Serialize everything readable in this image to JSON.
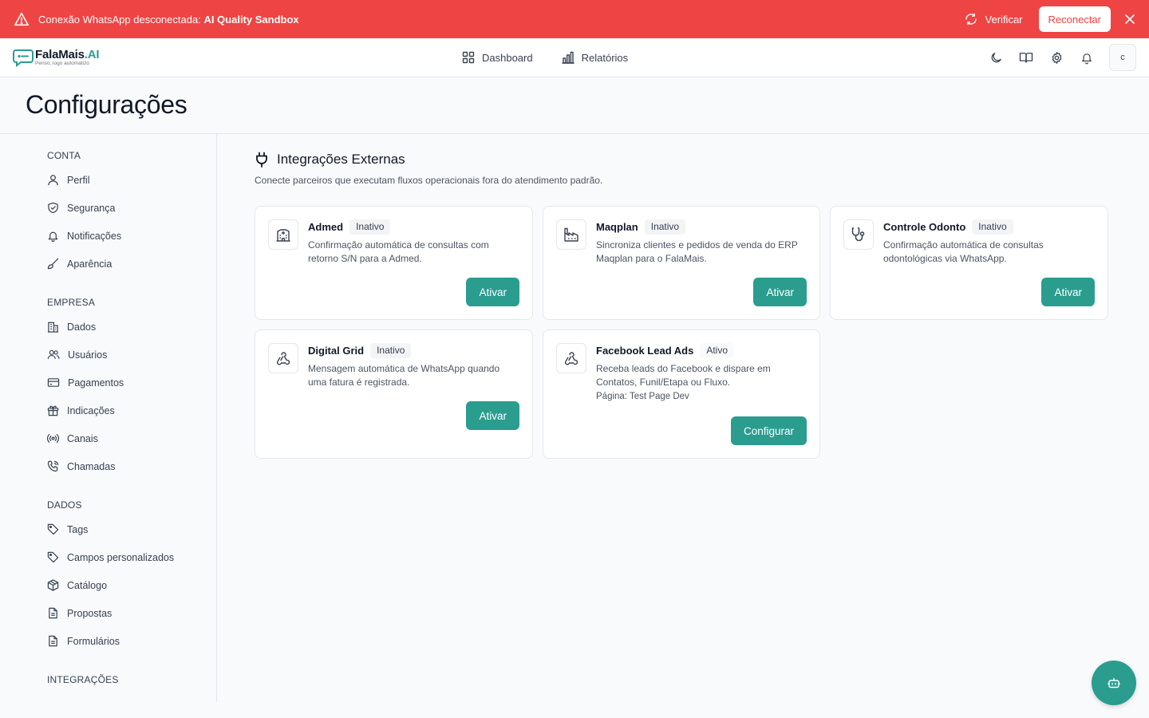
{
  "alert": {
    "message_prefix": "Conexão WhatsApp desconectada:",
    "connection_name": "AI Quality Sandbox",
    "verify_label": "Verificar",
    "reconnect_label": "Reconectar"
  },
  "logo": {
    "brand": "FalaMais",
    "brand_suffix": ".AI",
    "tagline": "Penso, logo automatizo"
  },
  "nav": {
    "dashboard_label": "Dashboard",
    "reports_label": "Relatórios",
    "avatar_initial": "c"
  },
  "page": {
    "title": "Configurações"
  },
  "sidebar": {
    "sections": [
      {
        "title": "CONTA",
        "items": [
          "Perfil",
          "Segurança",
          "Notificações",
          "Aparência"
        ]
      },
      {
        "title": "EMPRESA",
        "items": [
          "Dados",
          "Usuários",
          "Pagamentos",
          "Indicações",
          "Canais",
          "Chamadas"
        ]
      },
      {
        "title": "DADOS",
        "items": [
          "Tags",
          "Campos personalizados",
          "Catálogo",
          "Propostas",
          "Formulários"
        ]
      },
      {
        "title": "INTEGRAÇÕES",
        "items": []
      }
    ]
  },
  "integrations": {
    "title": "Integrações Externas",
    "description": "Conecte parceiros que executam fluxos operacionais fora do atendimento padrão.",
    "cards": [
      {
        "name": "Admed",
        "status": "Inativo",
        "description": "Confirmação automática de consultas com retorno S/N para a Admed.",
        "action": "Ativar",
        "icon": "hospital-icon"
      },
      {
        "name": "Maqplan",
        "status": "Inativo",
        "description": "Sincroniza clientes e pedidos de venda do ERP Maqplan para o FalaMais.",
        "action": "Ativar",
        "icon": "factory-icon"
      },
      {
        "name": "Controle Odonto",
        "status": "Inativo",
        "description": "Confirmação automática de consultas odontológicas via WhatsApp.",
        "action": "Ativar",
        "icon": "stethoscope-icon"
      },
      {
        "name": "Digital Grid",
        "status": "Inativo",
        "description": "Mensagem automática de WhatsApp quando uma fatura é registrada.",
        "action": "Ativar",
        "icon": "webhook-icon"
      },
      {
        "name": "Facebook Lead Ads",
        "status": "Ativo",
        "description": "Receba leads do Facebook e dispare em Contatos, Funil/Etapa ou Fluxo.",
        "extra": "Página: Test Page Dev",
        "action": "Configurar",
        "icon": "webhook-icon"
      }
    ]
  },
  "colors": {
    "alert_bg": "#ef4444",
    "accent": "#2a9d8f"
  }
}
